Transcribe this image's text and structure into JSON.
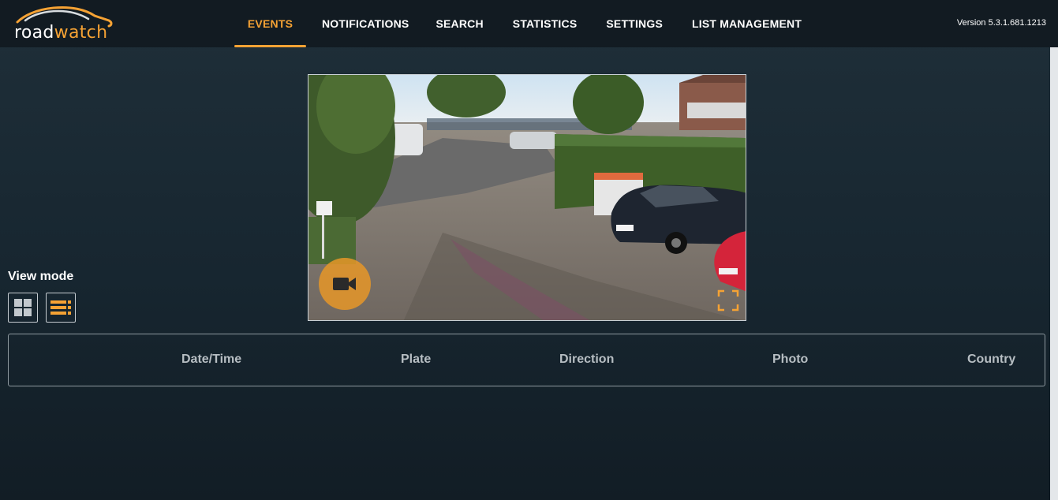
{
  "app": {
    "logo_part1": "road",
    "logo_part2": "watch",
    "version": "Version 5.3.1.681.1213",
    "accent_color": "#f5a234"
  },
  "nav": {
    "items": [
      {
        "label": "EVENTS",
        "active": true
      },
      {
        "label": "NOTIFICATIONS",
        "active": false
      },
      {
        "label": "SEARCH",
        "active": false
      },
      {
        "label": "STATISTICS",
        "active": false
      },
      {
        "label": "SETTINGS",
        "active": false
      },
      {
        "label": "LIST MANAGEMENT",
        "active": false
      }
    ]
  },
  "camera": {
    "icons": {
      "record": "video-camera-icon",
      "fullscreen": "fullscreen-icon"
    }
  },
  "view_mode": {
    "label": "View mode",
    "icons": {
      "grid": "grid-view-icon",
      "list": "list-view-icon"
    },
    "selected": "list"
  },
  "table": {
    "columns": [
      "Date/Time",
      "Plate",
      "Direction",
      "Photo",
      "Country"
    ]
  }
}
